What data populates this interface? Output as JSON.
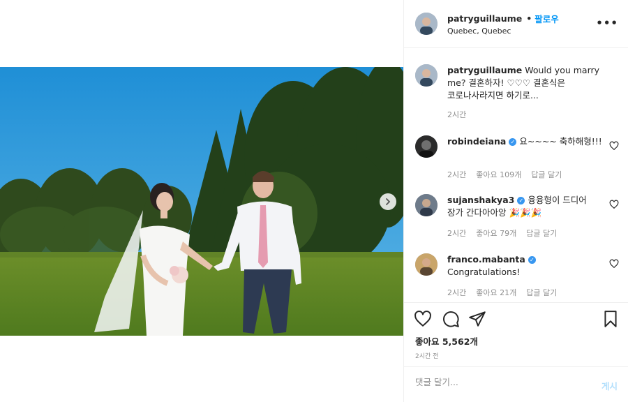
{
  "post": {
    "username": "patryguillaume",
    "separator": "•",
    "follow_label": "팔로우",
    "location": "Quebec, Quebec",
    "more_icon": "more-horizontal-icon"
  },
  "caption": {
    "username": "patryguillaume",
    "text": "Would you marry me? 결혼하자! ♡♡♡ 결혼식은 코로나사라지면 하기로...",
    "time": "2시간"
  },
  "comments": [
    {
      "username": "robindeiana",
      "verified": true,
      "text": "요~~~~ 축하해형!!!",
      "time": "2시간",
      "likes": "좋아요 109개",
      "reply": "답글 달기"
    },
    {
      "username": "sujanshakya3",
      "verified": true,
      "text": "융융형이 드디어 장가 간다아아앙 🎉🎉🎉",
      "time": "2시간",
      "likes": "좋아요 79개",
      "reply": "답글 달기"
    },
    {
      "username": "franco.mabanta",
      "verified": true,
      "text": "Congratulations!",
      "time": "2시간",
      "likes": "좋아요 21개",
      "reply": "답글 달기"
    }
  ],
  "actions": {
    "like_icon": "heart-icon",
    "comment_icon": "comment-icon",
    "share_icon": "send-icon",
    "save_icon": "bookmark-icon",
    "likes_count": "좋아요 5,562개",
    "posted_time": "2시간 전"
  },
  "composer": {
    "placeholder": "댓글 달기...",
    "post_label": "게시"
  },
  "colors": {
    "accent": "#0095f6",
    "post_disabled": "#b2dffc",
    "verified": "#3897f0"
  }
}
